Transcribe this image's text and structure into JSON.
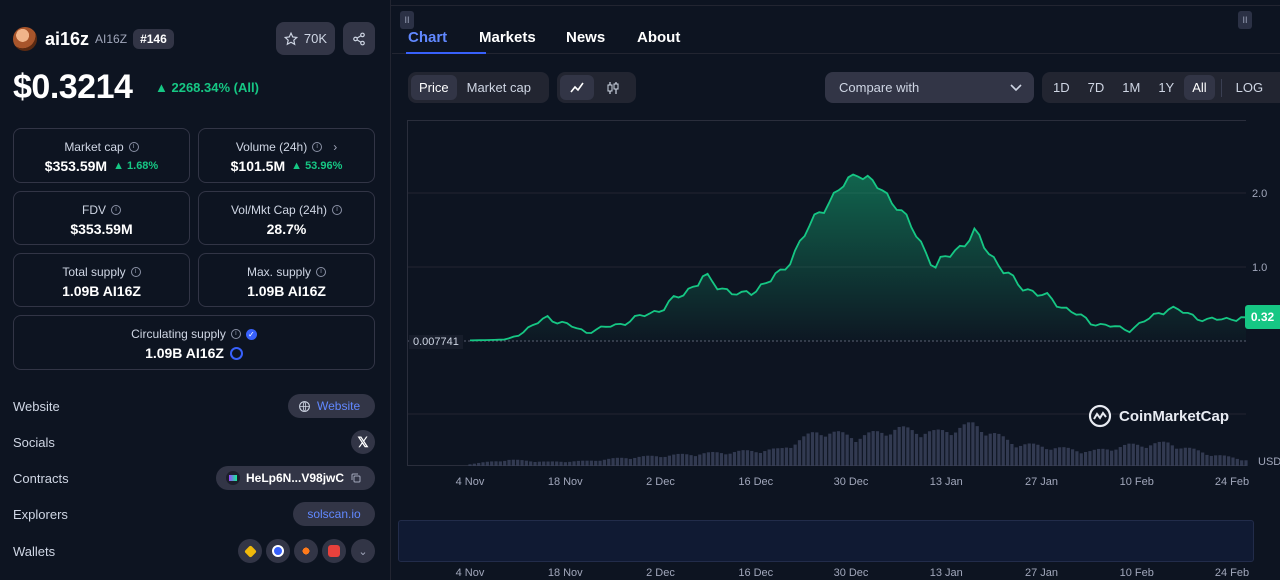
{
  "coin": {
    "name": "ai16z",
    "symbol": "AI16Z",
    "rank": "#146",
    "watchlist_count": "70K",
    "price": "$0.3214",
    "price_change": "2268.34% (All)"
  },
  "stats": {
    "market_cap": {
      "label": "Market cap",
      "value": "$353.59M",
      "change": "1.68%"
    },
    "volume": {
      "label": "Volume (24h)",
      "value": "$101.5M",
      "change": "53.96%"
    },
    "fdv": {
      "label": "FDV",
      "value": "$353.59M"
    },
    "vol_mkt_cap": {
      "label": "Vol/Mkt Cap (24h)",
      "value": "28.7%"
    },
    "total_supply": {
      "label": "Total supply",
      "value": "1.09B AI16Z"
    },
    "max_supply": {
      "label": "Max. supply",
      "value": "1.09B AI16Z"
    },
    "circulating_supply": {
      "label": "Circulating supply",
      "value": "1.09B AI16Z"
    }
  },
  "links": {
    "website_label": "Website",
    "website_value": "Website",
    "socials_label": "Socials",
    "contracts_label": "Contracts",
    "contract_value": "HeLp6N...V98jwC",
    "explorers_label": "Explorers",
    "explorer_value": "solscan.io",
    "wallets_label": "Wallets"
  },
  "tabs": [
    "Chart",
    "Markets",
    "News",
    "About"
  ],
  "chart_controls": {
    "price_label": "Price",
    "market_cap_label": "Market cap",
    "compare_label": "Compare with",
    "ranges": [
      "1D",
      "7D",
      "1M",
      "1Y",
      "All"
    ],
    "log_label": "LOG",
    "selected_range": "All"
  },
  "colors": {
    "accent": "#3861fb",
    "up": "#16c784",
    "background": "#0d1421"
  },
  "chart_data": {
    "type": "line",
    "x_ticks": [
      "4 Nov",
      "18 Nov",
      "2 Dec",
      "16 Dec",
      "30 Dec",
      "13 Jan",
      "27 Jan",
      "10 Feb",
      "24 Feb"
    ],
    "y_ticks": [
      "2.0",
      "1.0"
    ],
    "ylim": [
      0,
      2.5
    ],
    "y_unit": "USD",
    "baseline_label": "0.007741",
    "current_value_label": "0.32",
    "watermark": "CoinMarketCap",
    "series": [
      {
        "x": [
          "4 Nov",
          "11 Nov",
          "18 Nov",
          "25 Nov",
          "2 Dec",
          "9 Dec",
          "16 Dec",
          "20 Dec",
          "26 Dec",
          "30 Dec",
          "2 Jan",
          "6 Jan",
          "10 Jan",
          "13 Jan",
          "20 Jan",
          "27 Jan",
          "3 Feb",
          "10 Feb",
          "17 Feb",
          "24 Feb",
          "27 Feb"
        ],
        "values": [
          0.008,
          0.02,
          0.32,
          0.12,
          0.25,
          0.45,
          0.85,
          0.6,
          0.9,
          1.75,
          2.3,
          1.85,
          1.0,
          1.45,
          0.8,
          0.55,
          0.25,
          0.15,
          0.45,
          0.28,
          0.32
        ]
      }
    ],
    "volume_relative": [
      0.05,
      0.15,
      0.1,
      0.12,
      0.2,
      0.25,
      0.3,
      0.35,
      0.4,
      0.85,
      0.7,
      0.9,
      0.8,
      1.0,
      0.55,
      0.45,
      0.35,
      0.5,
      0.55,
      0.3,
      0.15
    ]
  }
}
